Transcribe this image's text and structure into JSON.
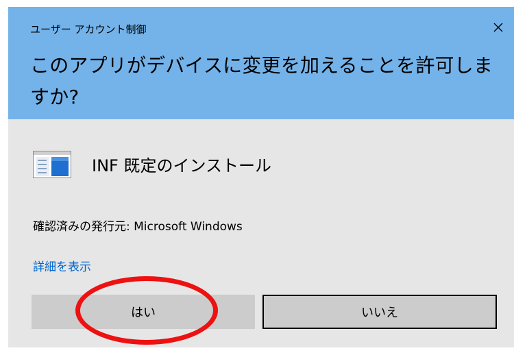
{
  "window": {
    "caption": "ユーザー アカウント制御",
    "close_icon": "close-icon"
  },
  "prompt": {
    "question": "このアプリがデバイスに変更を加えることを許可しますか?"
  },
  "app": {
    "icon": "installer-window-icon",
    "name": "INF 既定のインストール",
    "publisher": "確認済みの発行元: Microsoft Windows",
    "details_link": "詳細を表示"
  },
  "buttons": {
    "yes_label": "はい",
    "no_label": "いいえ"
  },
  "colors": {
    "header_bg": "#74b3ea",
    "body_bg": "#e6e6e6",
    "button_bg": "#cccccc",
    "link": "#0066cc",
    "annotation": "#ee1111"
  }
}
